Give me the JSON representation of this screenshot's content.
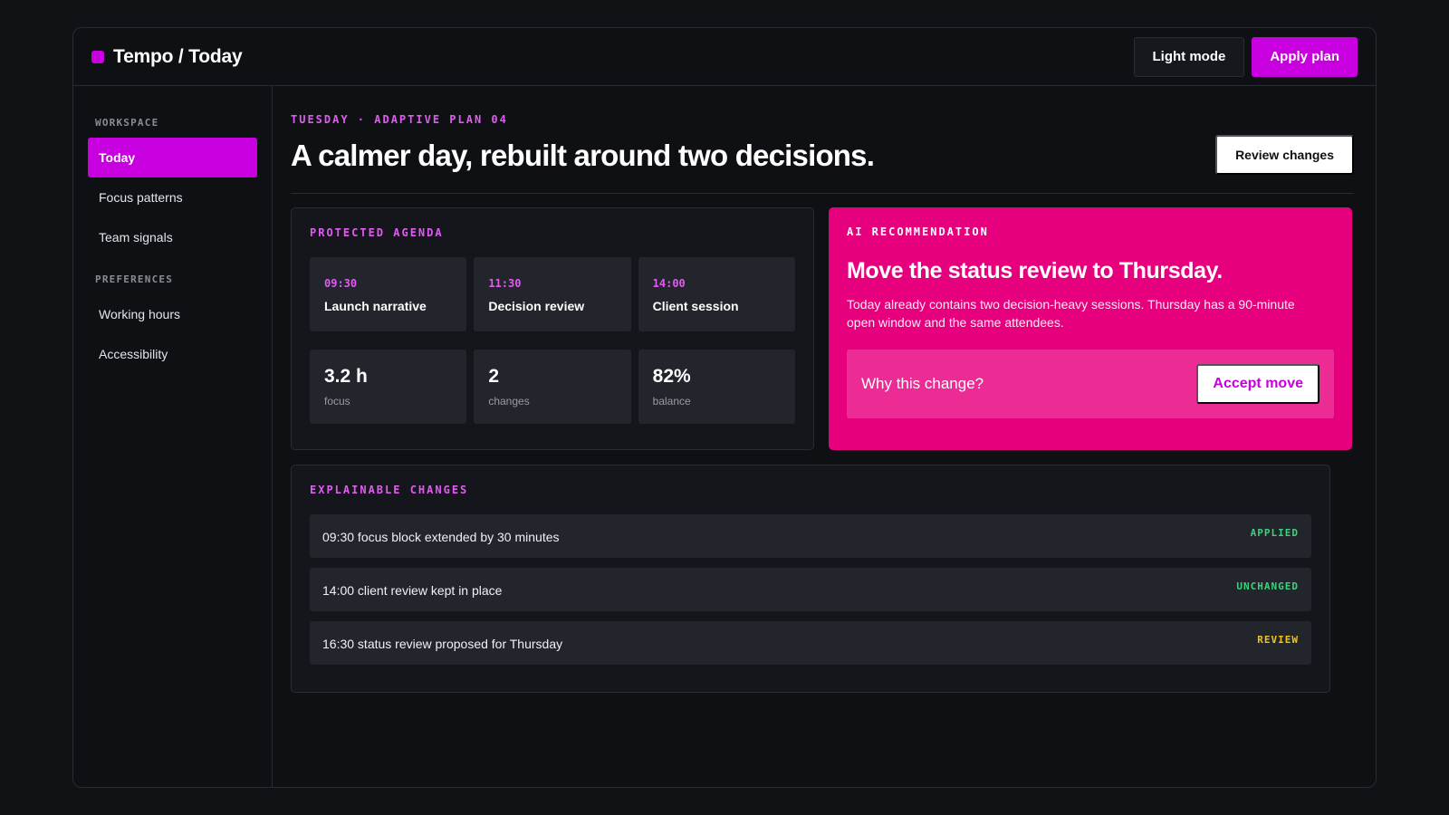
{
  "app": {
    "title": "Tempo / Today",
    "accent_color": "#c800e0",
    "pink_color": "#e6007e"
  },
  "topbar": {
    "light_mode_label": "Light mode",
    "apply_plan_label": "Apply plan"
  },
  "sidebar": {
    "sections": [
      {
        "title": "WORKSPACE",
        "items": [
          {
            "label": "Today",
            "active": true
          },
          {
            "label": "Focus patterns",
            "active": false
          },
          {
            "label": "Team signals",
            "active": false
          }
        ]
      },
      {
        "title": "PREFERENCES",
        "items": [
          {
            "label": "Working hours",
            "active": false
          },
          {
            "label": "Accessibility",
            "active": false
          }
        ]
      }
    ]
  },
  "main": {
    "eyebrow": "TUESDAY · ADAPTIVE PLAN 04",
    "headline": "A calmer day, rebuilt around two decisions.",
    "review_changes_label": "Review changes"
  },
  "agenda": {
    "label": "PROTECTED AGENDA",
    "slots": [
      {
        "time": "09:30",
        "name": "Launch narrative"
      },
      {
        "time": "11:30",
        "name": "Decision review"
      },
      {
        "time": "14:00",
        "name": "Client session"
      }
    ],
    "stats": [
      {
        "value": "3.2 h",
        "unit": "focus"
      },
      {
        "value": "2",
        "unit": "changes"
      },
      {
        "value": "82%",
        "unit": "balance"
      }
    ]
  },
  "recommendation": {
    "label": "AI RECOMMENDATION",
    "title": "Move the status review to Thursday.",
    "body": "Today already contains two decision-heavy sessions. Thursday has a 90-minute open window and the same attendees.",
    "question": "Why this change?",
    "accept_label": "Accept move"
  },
  "changes": {
    "label": "EXPLAINABLE CHANGES",
    "rows": [
      {
        "text": "09:30 focus block extended by 30 minutes",
        "status": "APPLIED",
        "status_color": "#3fd17a"
      },
      {
        "text": "14:00 client review kept in place",
        "status": "UNCHANGED",
        "status_color": "#3fd17a"
      },
      {
        "text": "16:30 status review proposed for Thursday",
        "status": "REVIEW",
        "status_color": "#f0c419"
      }
    ]
  }
}
